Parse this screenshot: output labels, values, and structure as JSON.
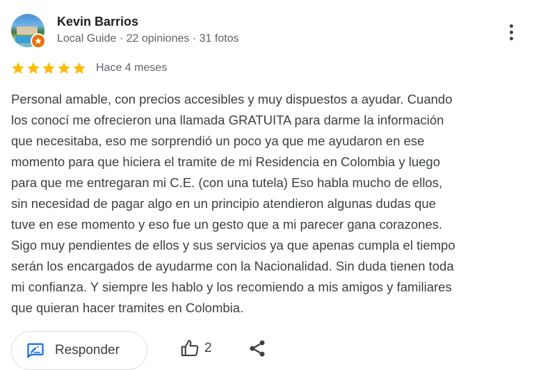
{
  "reviewer": {
    "name": "Kevin Barrios",
    "badge": "Local Guide",
    "separator": "·",
    "reviews_count": "22 opiniones",
    "photos_count": "31 fotos"
  },
  "rating": {
    "stars": 5,
    "max": 5,
    "star_color": "#fbbc04"
  },
  "date": "Hace 4 meses",
  "review_lines": [
    "Personal amable, con precios accesibles y muy dispuestos a ayudar. Cuando",
    "los conocí me ofrecieron una llamada GRATUITA para darme la información",
    "que necesitaba, eso me sorprendió un poco ya que me ayudaron en ese",
    "momento para que hiciera el tramite de mi Residencia en Colombia y luego",
    "para que me entregaran mi C.E. (con una tutela) Eso habla mucho de ellos,",
    "sin necesidad de pagar algo en un principio atendieron algunas dudas que",
    "tuve en ese momento y eso fue un gesto que a mi parecer gana corazones.",
    "Sigo muy pendientes de ellos y sus servicios ya que apenas cumpla el tiempo",
    "serán los encargados de ayudarme con la Nacionalidad. Sin duda tienen toda",
    "mi confianza. Y siempre les hablo y los recomiendo a mis amigos y familiares",
    "que quieran hacer tramites en Colombia."
  ],
  "actions": {
    "respond_label": "Responder",
    "likes_count": "2"
  },
  "icons": {
    "more": "more-vert-icon",
    "respond": "edit-reply-icon",
    "like": "thumb-up-icon",
    "share": "share-icon",
    "badge": "local-guide-star-icon"
  },
  "colors": {
    "accent": "#1a73e8",
    "badge_orange": "#e8710a",
    "text_secondary": "#5f6368"
  }
}
